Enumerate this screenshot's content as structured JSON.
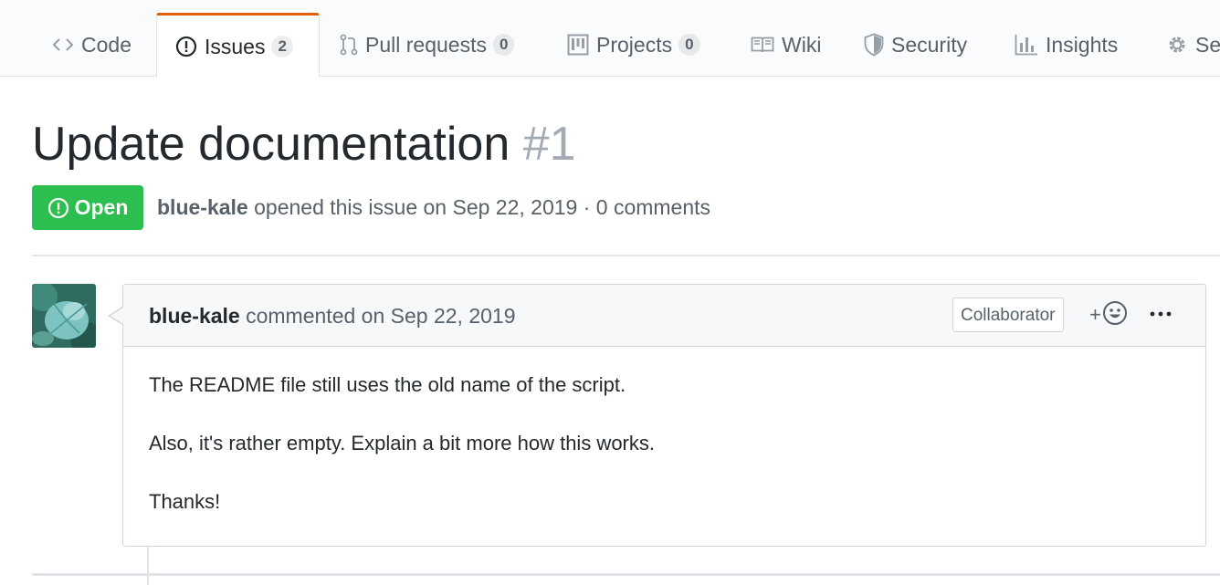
{
  "tabs": [
    {
      "label": "Code",
      "icon": "code-icon"
    },
    {
      "label": "Issues",
      "icon": "issue-opened-icon",
      "count": "2",
      "selected": true
    },
    {
      "label": "Pull requests",
      "icon": "git-pull-request-icon",
      "count": "0"
    },
    {
      "label": "Projects",
      "icon": "project-icon",
      "count": "0"
    },
    {
      "label": "Wiki",
      "icon": "book-icon"
    },
    {
      "label": "Security",
      "icon": "shield-icon"
    },
    {
      "label": "Insights",
      "icon": "graph-icon"
    },
    {
      "label": "Settings",
      "icon": "gear-icon"
    }
  ],
  "issue": {
    "title": "Update documentation",
    "number": "#1",
    "state": "Open",
    "author": "blue-kale",
    "meta_text": "opened this issue on Sep 22, 2019 · 0 comments"
  },
  "comment": {
    "author": "blue-kale",
    "meta_text": "commented on Sep 22, 2019",
    "role": "Collaborator",
    "reaction_plus": "+",
    "body": [
      "The README file still uses the old name of the script.",
      "Also, it's rather empty. Explain a bit more how this works.",
      "Thanks!"
    ]
  },
  "colors": {
    "open_state": "#2cbe4e",
    "selected_tab_accent": "#e36209"
  }
}
